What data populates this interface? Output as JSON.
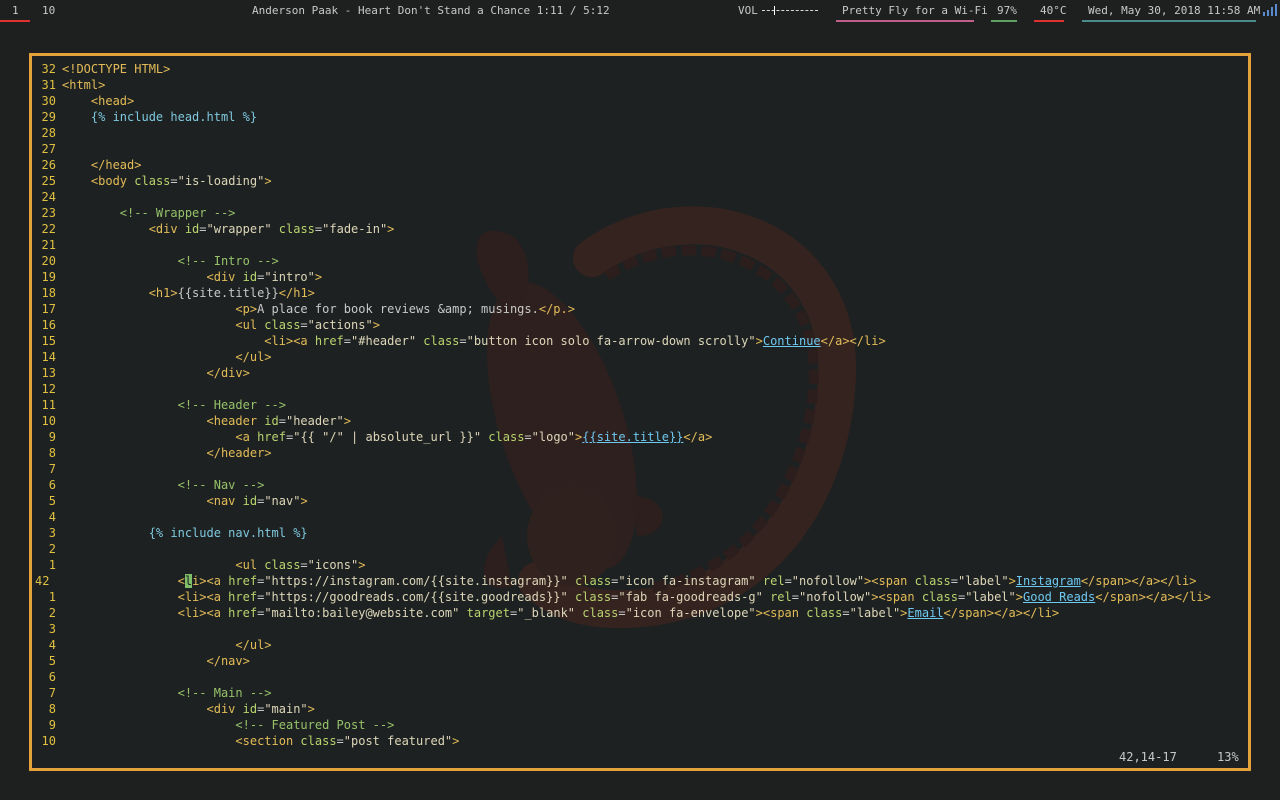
{
  "status_bar": {
    "workspace_active": "1",
    "workspace_other": "10",
    "now_playing": "Anderson Paak - Heart Don't Stand a Chance 1:11 / 5:12",
    "volume_label": "VOL",
    "volume_level": 0.22,
    "wifi_ssid": "Pretty Fly for a Wi-Fi",
    "battery": "97%",
    "temperature": "40°C",
    "datetime": "Wed, May 30, 2018   11:58 AM",
    "icons": [
      "signal-strength-icon"
    ],
    "colors": {
      "workspace_active": "#e03030",
      "wifi": "#c0608a",
      "battery": "#60a060",
      "temperature": "#e03030",
      "datetime": "#4a8a8a"
    }
  },
  "editor": {
    "border_color": "#e3a33a",
    "watermark": "enso-koi-fish",
    "ruler_position": "42,14-17",
    "ruler_percent": "13%",
    "lines": [
      {
        "n": "32",
        "c": [
          [
            "tag",
            "<!DOCTYPE HTML>"
          ]
        ]
      },
      {
        "n": "31",
        "c": [
          [
            "tag",
            "<html>"
          ]
        ]
      },
      {
        "n": "30",
        "c": [
          [
            "txt",
            "    "
          ],
          [
            "tag",
            "<head>"
          ]
        ]
      },
      {
        "n": "29",
        "c": [
          [
            "txt",
            "    "
          ],
          [
            "liquid",
            "{% include head.html %}"
          ]
        ]
      },
      {
        "n": "28",
        "c": []
      },
      {
        "n": "27",
        "c": []
      },
      {
        "n": "26",
        "c": [
          [
            "txt",
            "    "
          ],
          [
            "tag",
            "</head>"
          ]
        ]
      },
      {
        "n": "25",
        "c": [
          [
            "txt",
            "    "
          ],
          [
            "tag",
            "<body "
          ],
          [
            "attr",
            "class"
          ],
          [
            "txt",
            "="
          ],
          [
            "str",
            "\"is-loading\""
          ],
          [
            "tag",
            ">"
          ]
        ]
      },
      {
        "n": "24",
        "c": []
      },
      {
        "n": "23",
        "c": [
          [
            "txt",
            "        "
          ],
          [
            "cmt",
            "<!-- Wrapper -->"
          ]
        ]
      },
      {
        "n": "22",
        "c": [
          [
            "txt",
            "            "
          ],
          [
            "tag",
            "<div "
          ],
          [
            "attr",
            "id"
          ],
          [
            "txt",
            "="
          ],
          [
            "str",
            "\"wrapper\""
          ],
          [
            "txt",
            " "
          ],
          [
            "attr",
            "class"
          ],
          [
            "txt",
            "="
          ],
          [
            "str",
            "\"fade-in\""
          ],
          [
            "tag",
            ">"
          ]
        ]
      },
      {
        "n": "21",
        "c": []
      },
      {
        "n": "20",
        "c": [
          [
            "txt",
            "                "
          ],
          [
            "cmt",
            "<!-- Intro -->"
          ]
        ]
      },
      {
        "n": "19",
        "c": [
          [
            "txt",
            "                    "
          ],
          [
            "tag",
            "<div "
          ],
          [
            "attr",
            "id"
          ],
          [
            "txt",
            "="
          ],
          [
            "str",
            "\"intro\""
          ],
          [
            "tag",
            ">"
          ]
        ]
      },
      {
        "n": "18",
        "c": [
          [
            "txt",
            "            "
          ],
          [
            "tag",
            "<h1>"
          ],
          [
            "txt",
            "{{site.title}}"
          ],
          [
            "tag",
            "</h1>"
          ]
        ]
      },
      {
        "n": "17",
        "c": [
          [
            "txt",
            "                        "
          ],
          [
            "tag",
            "<p>"
          ],
          [
            "txt",
            "A place for book reviews &amp; musings."
          ],
          [
            "tag",
            "</p.>"
          ]
        ]
      },
      {
        "n": "16",
        "c": [
          [
            "txt",
            "                        "
          ],
          [
            "tag",
            "<ul "
          ],
          [
            "attr",
            "class"
          ],
          [
            "txt",
            "="
          ],
          [
            "str",
            "\"actions\""
          ],
          [
            "tag",
            ">"
          ]
        ]
      },
      {
        "n": "15",
        "c": [
          [
            "txt",
            "                            "
          ],
          [
            "tag",
            "<li><a "
          ],
          [
            "attr",
            "href"
          ],
          [
            "txt",
            "="
          ],
          [
            "str",
            "\"#header\""
          ],
          [
            "txt",
            " "
          ],
          [
            "attr",
            "class"
          ],
          [
            "txt",
            "="
          ],
          [
            "str",
            "\"button icon solo fa-arrow-down scrolly\""
          ],
          [
            "tag",
            ">"
          ],
          [
            "lnk",
            "Continue"
          ],
          [
            "tag",
            "</a></li>"
          ]
        ]
      },
      {
        "n": "14",
        "c": [
          [
            "txt",
            "                        "
          ],
          [
            "tag",
            "</ul>"
          ]
        ]
      },
      {
        "n": "13",
        "c": [
          [
            "txt",
            "                    "
          ],
          [
            "tag",
            "</div>"
          ]
        ]
      },
      {
        "n": "12",
        "c": []
      },
      {
        "n": "11",
        "c": [
          [
            "txt",
            "                "
          ],
          [
            "cmt",
            "<!-- Header -->"
          ]
        ]
      },
      {
        "n": "10",
        "c": [
          [
            "txt",
            "                    "
          ],
          [
            "tag",
            "<header "
          ],
          [
            "attr",
            "id"
          ],
          [
            "txt",
            "="
          ],
          [
            "str",
            "\"header\""
          ],
          [
            "tag",
            ">"
          ]
        ]
      },
      {
        "n": "9",
        "c": [
          [
            "txt",
            "                        "
          ],
          [
            "tag",
            "<a "
          ],
          [
            "attr",
            "href"
          ],
          [
            "txt",
            "="
          ],
          [
            "str",
            "\"{{ \"/\" | absolute_url }}\""
          ],
          [
            "txt",
            " "
          ],
          [
            "attr",
            "class"
          ],
          [
            "txt",
            "="
          ],
          [
            "str",
            "\"logo\""
          ],
          [
            "tag",
            ">"
          ],
          [
            "lnk",
            "{{site.title}}"
          ],
          [
            "tag",
            "</a>"
          ]
        ]
      },
      {
        "n": "8",
        "c": [
          [
            "txt",
            "                    "
          ],
          [
            "tag",
            "</header>"
          ]
        ]
      },
      {
        "n": "7",
        "c": []
      },
      {
        "n": "6",
        "c": [
          [
            "txt",
            "                "
          ],
          [
            "cmt",
            "<!-- Nav -->"
          ]
        ]
      },
      {
        "n": "5",
        "c": [
          [
            "txt",
            "                    "
          ],
          [
            "tag",
            "<nav "
          ],
          [
            "attr",
            "id"
          ],
          [
            "txt",
            "="
          ],
          [
            "str",
            "\"nav\""
          ],
          [
            "tag",
            ">"
          ]
        ]
      },
      {
        "n": "4",
        "c": []
      },
      {
        "n": "3",
        "c": [
          [
            "txt",
            "            "
          ],
          [
            "liquid",
            "{% include nav.html %}"
          ]
        ]
      },
      {
        "n": "2",
        "c": []
      },
      {
        "n": "1",
        "c": [
          [
            "txt",
            "                        "
          ],
          [
            "tag",
            "<ul "
          ],
          [
            "attr",
            "class"
          ],
          [
            "txt",
            "="
          ],
          [
            "str",
            "\"icons\""
          ],
          [
            "tag",
            ">"
          ]
        ]
      },
      {
        "n": "42",
        "cur": true,
        "c": [
          [
            "txt",
            "                "
          ],
          [
            "tag",
            "<"
          ],
          [
            "cursor",
            "l"
          ],
          [
            "tag",
            "i><a "
          ],
          [
            "attr",
            "href"
          ],
          [
            "txt",
            "="
          ],
          [
            "str",
            "\"https://instagram.com/{{site.instagram}}\""
          ],
          [
            "txt",
            " "
          ],
          [
            "attr",
            "class"
          ],
          [
            "txt",
            "="
          ],
          [
            "str",
            "\"icon fa-instagram\""
          ],
          [
            "txt",
            " "
          ],
          [
            "attr",
            "rel"
          ],
          [
            "txt",
            "="
          ],
          [
            "str",
            "\"nofollow\""
          ],
          [
            "tag",
            "><span "
          ],
          [
            "attr",
            "class"
          ],
          [
            "txt",
            "="
          ],
          [
            "str",
            "\"label\""
          ],
          [
            "tag",
            ">"
          ],
          [
            "lnk",
            "Instagram"
          ],
          [
            "tag",
            "</span></a></li>"
          ]
        ]
      },
      {
        "n": "1",
        "c": [
          [
            "txt",
            "                "
          ],
          [
            "tag",
            "<li><a "
          ],
          [
            "attr",
            "href"
          ],
          [
            "txt",
            "="
          ],
          [
            "str",
            "\"https://goodreads.com/{{site.goodreads}}\""
          ],
          [
            "txt",
            " "
          ],
          [
            "attr",
            "class"
          ],
          [
            "txt",
            "="
          ],
          [
            "str",
            "\"fab fa-goodreads-g\""
          ],
          [
            "txt",
            " "
          ],
          [
            "attr",
            "rel"
          ],
          [
            "txt",
            "="
          ],
          [
            "str",
            "\"nofollow\""
          ],
          [
            "tag",
            "><span "
          ],
          [
            "attr",
            "class"
          ],
          [
            "txt",
            "="
          ],
          [
            "str",
            "\"label\""
          ],
          [
            "tag",
            ">"
          ],
          [
            "lnk",
            "Good Reads"
          ],
          [
            "tag",
            "</span></a></li>"
          ]
        ]
      },
      {
        "n": "2",
        "c": [
          [
            "txt",
            "                "
          ],
          [
            "tag",
            "<li><a "
          ],
          [
            "attr",
            "href"
          ],
          [
            "txt",
            "="
          ],
          [
            "str",
            "\"mailto:bailey@website.com\""
          ],
          [
            "txt",
            " "
          ],
          [
            "attr",
            "target"
          ],
          [
            "txt",
            "="
          ],
          [
            "str",
            "\"_blank\""
          ],
          [
            "txt",
            " "
          ],
          [
            "attr",
            "class"
          ],
          [
            "txt",
            "="
          ],
          [
            "str",
            "\"icon fa-envelope\""
          ],
          [
            "tag",
            "><span "
          ],
          [
            "attr",
            "class"
          ],
          [
            "txt",
            "="
          ],
          [
            "str",
            "\"label\""
          ],
          [
            "tag",
            ">"
          ],
          [
            "lnk",
            "Email"
          ],
          [
            "tag",
            "</span></a></li>"
          ]
        ]
      },
      {
        "n": "3",
        "c": []
      },
      {
        "n": "4",
        "c": [
          [
            "txt",
            "                        "
          ],
          [
            "tag",
            "</ul>"
          ]
        ]
      },
      {
        "n": "5",
        "c": [
          [
            "txt",
            "                    "
          ],
          [
            "tag",
            "</nav>"
          ]
        ]
      },
      {
        "n": "6",
        "c": []
      },
      {
        "n": "7",
        "c": [
          [
            "txt",
            "                "
          ],
          [
            "cmt",
            "<!-- Main -->"
          ]
        ]
      },
      {
        "n": "8",
        "c": [
          [
            "txt",
            "                    "
          ],
          [
            "tag",
            "<div "
          ],
          [
            "attr",
            "id"
          ],
          [
            "txt",
            "="
          ],
          [
            "str",
            "\"main\""
          ],
          [
            "tag",
            ">"
          ]
        ]
      },
      {
        "n": "9",
        "c": [
          [
            "txt",
            "                        "
          ],
          [
            "cmt",
            "<!-- Featured Post -->"
          ]
        ]
      },
      {
        "n": "10",
        "c": [
          [
            "txt",
            "                        "
          ],
          [
            "tag",
            "<section "
          ],
          [
            "attr",
            "class"
          ],
          [
            "txt",
            "="
          ],
          [
            "str",
            "\"post featured\""
          ],
          [
            "tag",
            ">"
          ]
        ]
      }
    ]
  }
}
